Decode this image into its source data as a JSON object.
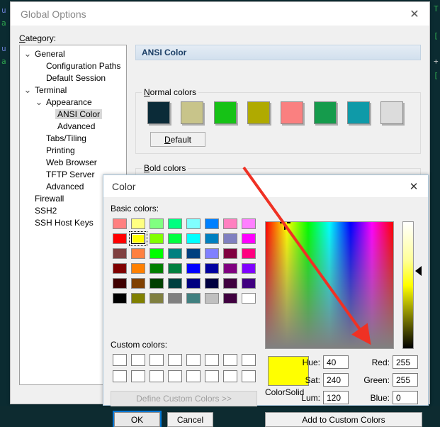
{
  "terminal": {
    "left_lines": [
      "u",
      "a",
      "u",
      "a"
    ],
    "right_lines": [
      "T",
      "l",
      "[",
      "+",
      "["
    ]
  },
  "global_options": {
    "title": "Global Options",
    "close_icon": "close-icon",
    "category_label": "Category:",
    "tree": [
      {
        "label": "General",
        "indent": 0,
        "chevron": "v",
        "selected": false
      },
      {
        "label": "Configuration Paths",
        "indent": 1,
        "chevron": "",
        "selected": false
      },
      {
        "label": "Default Session",
        "indent": 1,
        "chevron": "",
        "selected": false
      },
      {
        "label": "Terminal",
        "indent": 0,
        "chevron": "v",
        "selected": false
      },
      {
        "label": "Appearance",
        "indent": 1,
        "chevron": "v",
        "selected": false
      },
      {
        "label": "ANSI Color",
        "indent": 2,
        "chevron": "",
        "selected": true
      },
      {
        "label": "Advanced",
        "indent": 2,
        "chevron": "",
        "selected": false
      },
      {
        "label": "Tabs/Tiling",
        "indent": 1,
        "chevron": "",
        "selected": false
      },
      {
        "label": "Printing",
        "indent": 1,
        "chevron": "",
        "selected": false
      },
      {
        "label": "Web Browser",
        "indent": 1,
        "chevron": "",
        "selected": false
      },
      {
        "label": "TFTP Server",
        "indent": 1,
        "chevron": "",
        "selected": false
      },
      {
        "label": "Advanced",
        "indent": 1,
        "chevron": "",
        "selected": false
      },
      {
        "label": "Firewall",
        "indent": 0,
        "chevron": "",
        "selected": false
      },
      {
        "label": "SSH2",
        "indent": 0,
        "chevron": "",
        "selected": false
      },
      {
        "label": "SSH Host Keys",
        "indent": 0,
        "chevron": "",
        "selected": false
      }
    ],
    "panel": {
      "header": "ANSI Color",
      "normal_group_title": "Normal colors",
      "normal_colors": [
        "#0b2b38",
        "#c8c48a",
        "#16c216",
        "#b0aa00",
        "#fa8080",
        "#159b4c",
        "#0f9aa8",
        "#dcdcdc"
      ],
      "default_button": "Default",
      "bold_group_title": "Bold colors",
      "bold_colors": [
        "#2ce8e8",
        "#f97d40",
        "#19f019",
        "#ffff00",
        "#7a7aee",
        "#f618f6",
        "#f8832e",
        "#2ce8e8"
      ]
    }
  },
  "color_dialog": {
    "title": "Color",
    "close_icon": "close-icon",
    "basic_colors_label": "Basic colors:",
    "basic_colors": [
      "#ff8080",
      "#ffff80",
      "#80ff80",
      "#00ff80",
      "#80ffff",
      "#0080ff",
      "#ff80c0",
      "#ff80ff",
      "#ff0000",
      "#ffff00",
      "#80ff00",
      "#00ff40",
      "#00ffff",
      "#0080c0",
      "#8080c0",
      "#ff00ff",
      "#804040",
      "#ff8040",
      "#00ff00",
      "#008080",
      "#004080",
      "#8080ff",
      "#800040",
      "#ff0080",
      "#800000",
      "#ff8000",
      "#008000",
      "#008040",
      "#0000ff",
      "#0000a0",
      "#800080",
      "#8000ff",
      "#400000",
      "#804000",
      "#004000",
      "#004040",
      "#000080",
      "#000040",
      "#400040",
      "#400080",
      "#000000",
      "#808000",
      "#808040",
      "#808080",
      "#408080",
      "#c0c0c0",
      "#400040",
      "#ffffff"
    ],
    "selected_basic_index": 9,
    "custom_colors_label": "Custom colors:",
    "custom_colors": [
      "#ffffff",
      "#ffffff",
      "#ffffff",
      "#ffffff",
      "#ffffff",
      "#ffffff",
      "#ffffff",
      "#ffffff",
      "#ffffff",
      "#ffffff",
      "#ffffff",
      "#ffffff",
      "#ffffff",
      "#ffffff",
      "#ffffff",
      "#ffffff"
    ],
    "define_custom_button": "Define Custom Colors >>",
    "ok_button": "OK",
    "cancel_button": "Cancel",
    "add_to_custom_button": "Add to Custom Colors",
    "color_solid_label": "ColorSolid",
    "color_solid_value": "#ffff00",
    "fields": {
      "hue_label": "Hue:",
      "hue_value": "40",
      "sat_label": "Sat:",
      "sat_value": "240",
      "lum_label": "Lum:",
      "lum_value": "120",
      "red_label": "Red:",
      "red_value": "255",
      "green_label": "Green:",
      "green_value": "255",
      "blue_label": "Blue:",
      "blue_value": "0"
    }
  },
  "annotation": {
    "arrow_color": "#ef3124"
  }
}
